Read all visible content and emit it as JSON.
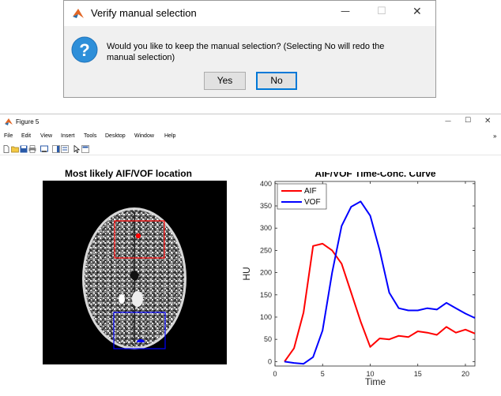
{
  "dialog": {
    "title": "Verify manual selection",
    "message": "Would you like to keep the manual selection? (Selecting No will redo the manual selection)",
    "yes_label": "Yes",
    "no_label": "No",
    "controls": {
      "minimize": "—",
      "maximize": "☐",
      "close": "✕"
    }
  },
  "figure": {
    "title": "Figure 5",
    "controls": {
      "minimize": "—",
      "maximize": "☐",
      "close": "✕"
    },
    "menu": [
      "File",
      "Edit",
      "View",
      "Insert",
      "Tools",
      "Desktop",
      "Window",
      "Help"
    ],
    "menu_overflow": "»"
  },
  "image_axes": {
    "title": "Most likely AIF/VOF location",
    "aif_color": "#ff0000",
    "vof_color": "#0000ff"
  },
  "chart_data": {
    "type": "line",
    "title": "AIF/VOF Time-Conc. Curve",
    "xlabel": "Time",
    "ylabel": "HU",
    "xlim": [
      0,
      21
    ],
    "ylim": [
      -10,
      405
    ],
    "xticks": [
      0,
      5,
      10,
      15,
      20
    ],
    "yticks": [
      0,
      50,
      100,
      150,
      200,
      250,
      300,
      350,
      400
    ],
    "legend_position": "top-left",
    "grid": false,
    "series": [
      {
        "name": "AIF",
        "color": "#ff0000",
        "x": [
          1,
          2,
          3,
          4,
          5,
          6,
          7,
          8,
          9,
          10,
          11,
          12,
          13,
          14,
          15,
          16,
          17,
          18,
          19,
          20,
          21
        ],
        "y": [
          0,
          30,
          110,
          260,
          265,
          250,
          220,
          155,
          90,
          33,
          52,
          50,
          58,
          55,
          68,
          65,
          60,
          78,
          65,
          72,
          63
        ]
      },
      {
        "name": "VOF",
        "color": "#0000ff",
        "x": [
          1,
          2,
          3,
          4,
          5,
          6,
          7,
          8,
          9,
          10,
          11,
          12,
          13,
          14,
          15,
          16,
          17,
          18,
          19,
          20,
          21
        ],
        "y": [
          0,
          -3,
          -5,
          10,
          70,
          200,
          305,
          348,
          360,
          328,
          250,
          155,
          120,
          115,
          115,
          120,
          117,
          132,
          120,
          108,
          98
        ]
      }
    ]
  }
}
